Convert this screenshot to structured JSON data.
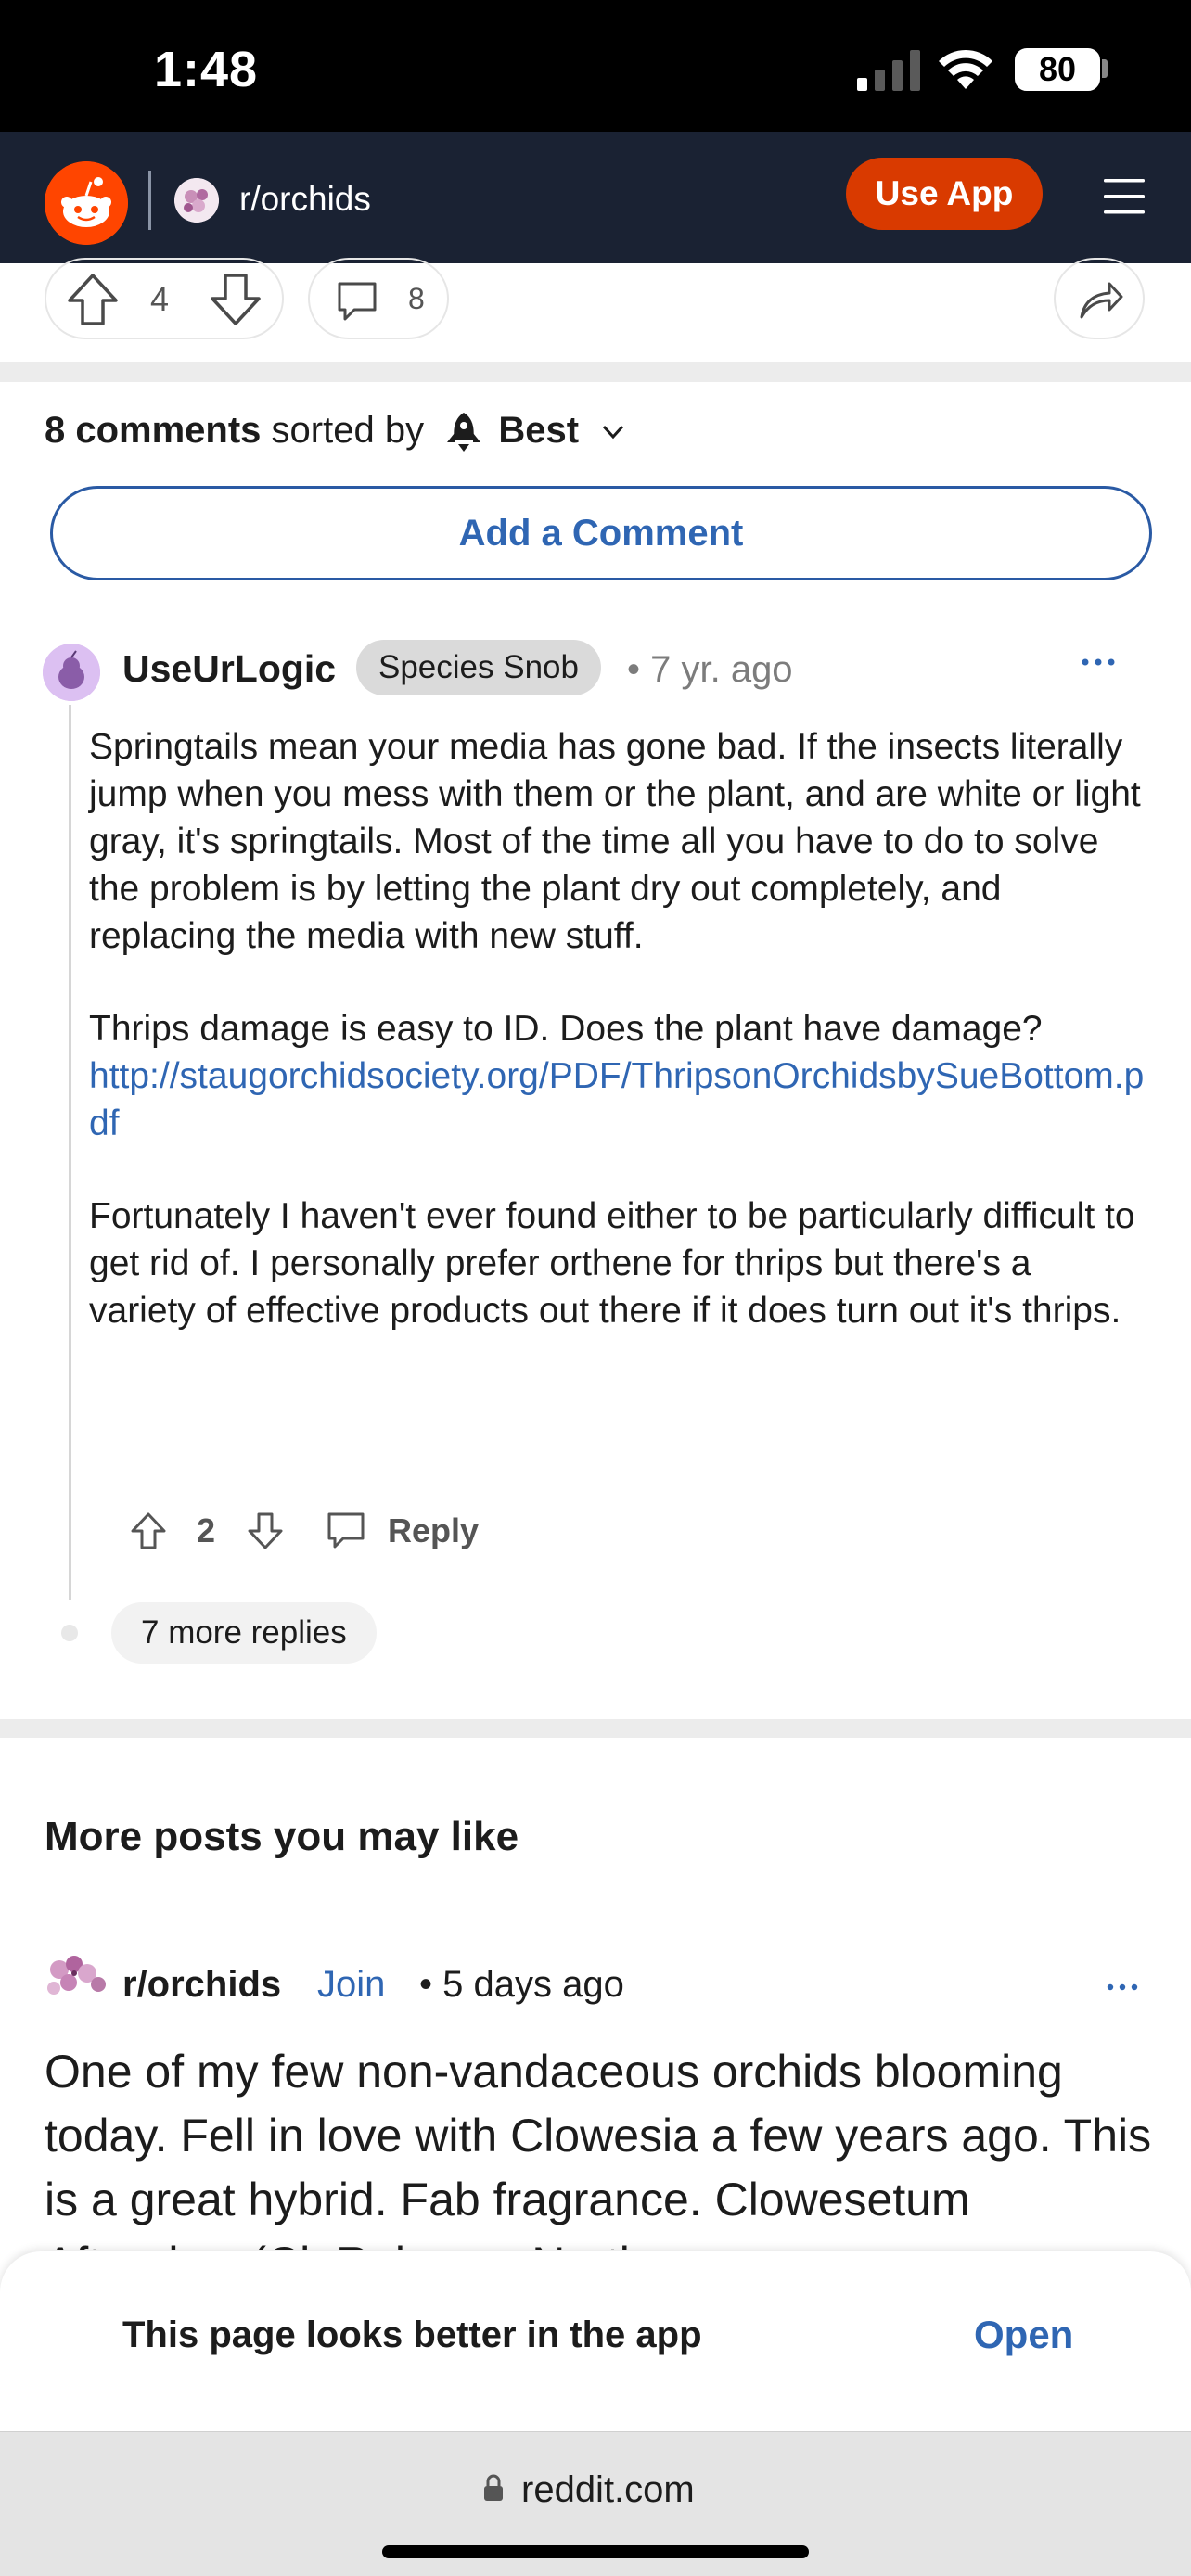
{
  "status_bar": {
    "time": "1:48",
    "battery": "80"
  },
  "header": {
    "subreddit": "r/orchids",
    "use_app_label": "Use App"
  },
  "post_actions": {
    "vote_count": "4",
    "comment_count": "8"
  },
  "comments_header": {
    "count_label": "8 comments",
    "sorted_by_label": "sorted by",
    "sort_value": "Best"
  },
  "add_comment_label": "Add a Comment",
  "comment": {
    "author": "UseUrLogic",
    "flair": "Species Snob",
    "time": "• 7 yr. ago",
    "paragraph1": "Springtails mean your media has gone bad. If the insects literally jump when you mess with them or the plant, and are white or light gray, it's springtails. Most of the time all you have to do to solve the problem is by letting the plant dry out completely, and replacing the media with new stuff.",
    "paragraph2_text": "Thrips damage is easy to ID. Does the plant have damage?",
    "paragraph2_link": "http://staugorchidsociety.org/PDF/ThripsonOrchidsbySueBottom.pdf",
    "paragraph3": "Fortunately I haven't ever found either to be particularly difficult to get rid of. I personally prefer orthene for thrips but there's a variety of effective products out there if it does turn out it's thrips.",
    "score": "2",
    "reply_label": "Reply",
    "more_replies": "7 more replies"
  },
  "more_posts": {
    "title": "More posts you may like",
    "post": {
      "subreddit": "r/orchids",
      "join_label": "Join",
      "time": "• 5 days ago",
      "title": "One of my few non-vandaceous orchids blooming today. Fell in love with Clowesia a few years ago. This is a great hybrid. Fab fragrance. Clowesetum Afterglow (Cl. Rebecca Northen x"
    }
  },
  "app_banner": {
    "text": "This page looks better in the app",
    "open_label": "Open"
  },
  "browser": {
    "url": "reddit.com"
  },
  "colors": {
    "reddit_orange": "#ff4500",
    "header_bg": "#1a2233",
    "link_blue": "#2f66b3",
    "use_app_btn": "#d93a00"
  }
}
